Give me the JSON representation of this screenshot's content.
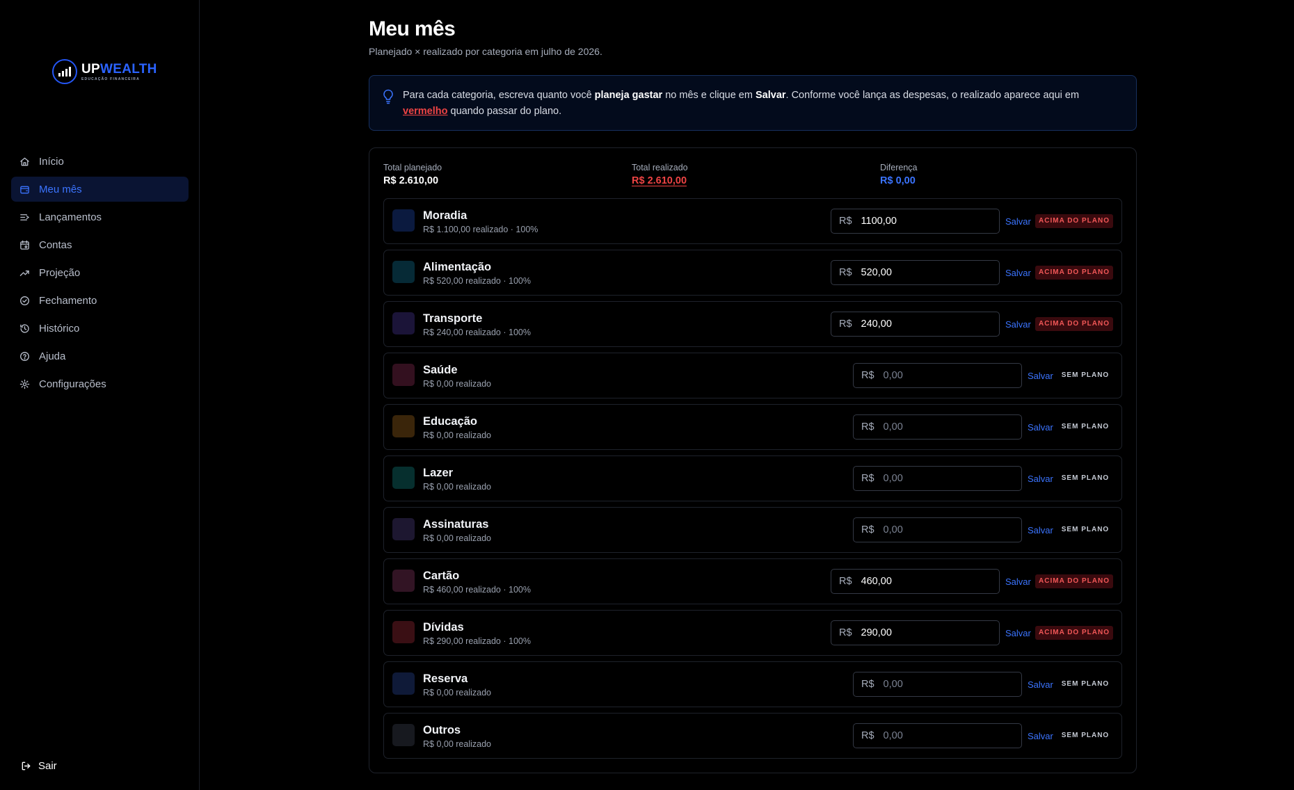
{
  "brand": {
    "name_up": "UP",
    "name_wealth": "WEALTH",
    "tagline": "EDUCAÇÃO FINANCEIRA"
  },
  "nav": [
    {
      "label": "Início",
      "icon": "home-icon",
      "active": false
    },
    {
      "label": "Meu mês",
      "icon": "wallet-icon",
      "active": true
    },
    {
      "label": "Lançamentos",
      "icon": "list-arrow-icon",
      "active": false
    },
    {
      "label": "Contas",
      "icon": "calendar-icon",
      "active": false
    },
    {
      "label": "Projeção",
      "icon": "trend-up-icon",
      "active": false
    },
    {
      "label": "Fechamento",
      "icon": "check-circle-icon",
      "active": false
    },
    {
      "label": "Histórico",
      "icon": "history-icon",
      "active": false
    },
    {
      "label": "Ajuda",
      "icon": "help-circle-icon",
      "active": false
    },
    {
      "label": "Configurações",
      "icon": "gear-icon",
      "active": false
    }
  ],
  "logout_label": "Sair",
  "page": {
    "title": "Meu mês",
    "subtitle": "Planejado × realizado por categoria em julho de 2026."
  },
  "tip": {
    "t1": "Para cada categoria, escreva quanto você ",
    "b1": "planeja gastar",
    "t2": " no mês e clique em ",
    "b2": "Salvar",
    "t3": ". Conforme você lança as despesas, o realizado aparece aqui em ",
    "red": "vermelho",
    "t4": " quando passar do plano."
  },
  "totals": {
    "planned_label": "Total planejado",
    "planned_value": "R$ 2.610,00",
    "realized_label": "Total realizado",
    "realized_value": "R$ 2.610,00",
    "diff_label": "Diferença",
    "diff_value": "R$ 0,00"
  },
  "currency": "R$",
  "save_label": "Salvar",
  "placeholder": "0,00",
  "categories": [
    {
      "name": "Moradia",
      "info": "R$ 1.100,00 realizado · 100%",
      "value": "1100,00",
      "status": "ACIMA DO PLANO",
      "over": true,
      "color": "#0b1a3f"
    },
    {
      "name": "Alimentação",
      "info": "R$ 520,00 realizado · 100%",
      "value": "520,00",
      "status": "ACIMA DO PLANO",
      "over": true,
      "color": "#062a36"
    },
    {
      "name": "Transporte",
      "info": "R$ 240,00 realizado · 100%",
      "value": "240,00",
      "status": "ACIMA DO PLANO",
      "over": true,
      "color": "#1b1438"
    },
    {
      "name": "Saúde",
      "info": "R$ 0,00 realizado",
      "value": "",
      "status": "SEM PLANO",
      "over": false,
      "color": "#33101f"
    },
    {
      "name": "Educação",
      "info": "R$ 0,00 realizado",
      "value": "",
      "status": "SEM PLANO",
      "over": false,
      "color": "#3a250a"
    },
    {
      "name": "Lazer",
      "info": "R$ 0,00 realizado",
      "value": "",
      "status": "SEM PLANO",
      "over": false,
      "color": "#062f2e"
    },
    {
      "name": "Assinaturas",
      "info": "R$ 0,00 realizado",
      "value": "",
      "status": "SEM PLANO",
      "over": false,
      "color": "#1d1730"
    },
    {
      "name": "Cartão",
      "info": "R$ 460,00 realizado · 100%",
      "value": "460,00",
      "status": "ACIMA DO PLANO",
      "over": true,
      "color": "#321424"
    },
    {
      "name": "Dívidas",
      "info": "R$ 290,00 realizado · 100%",
      "value": "290,00",
      "status": "ACIMA DO PLANO",
      "over": true,
      "color": "#3a0f14"
    },
    {
      "name": "Reserva",
      "info": "R$ 0,00 realizado",
      "value": "",
      "status": "SEM PLANO",
      "over": false,
      "color": "#0f1a38"
    },
    {
      "name": "Outros",
      "info": "R$ 0,00 realizado",
      "value": "",
      "status": "SEM PLANO",
      "over": false,
      "color": "#17191f"
    }
  ],
  "colors": {
    "accent": "#3b74ff",
    "danger": "#ef4444",
    "active_bg": "#0a1433",
    "tip_border": "#17305f"
  }
}
